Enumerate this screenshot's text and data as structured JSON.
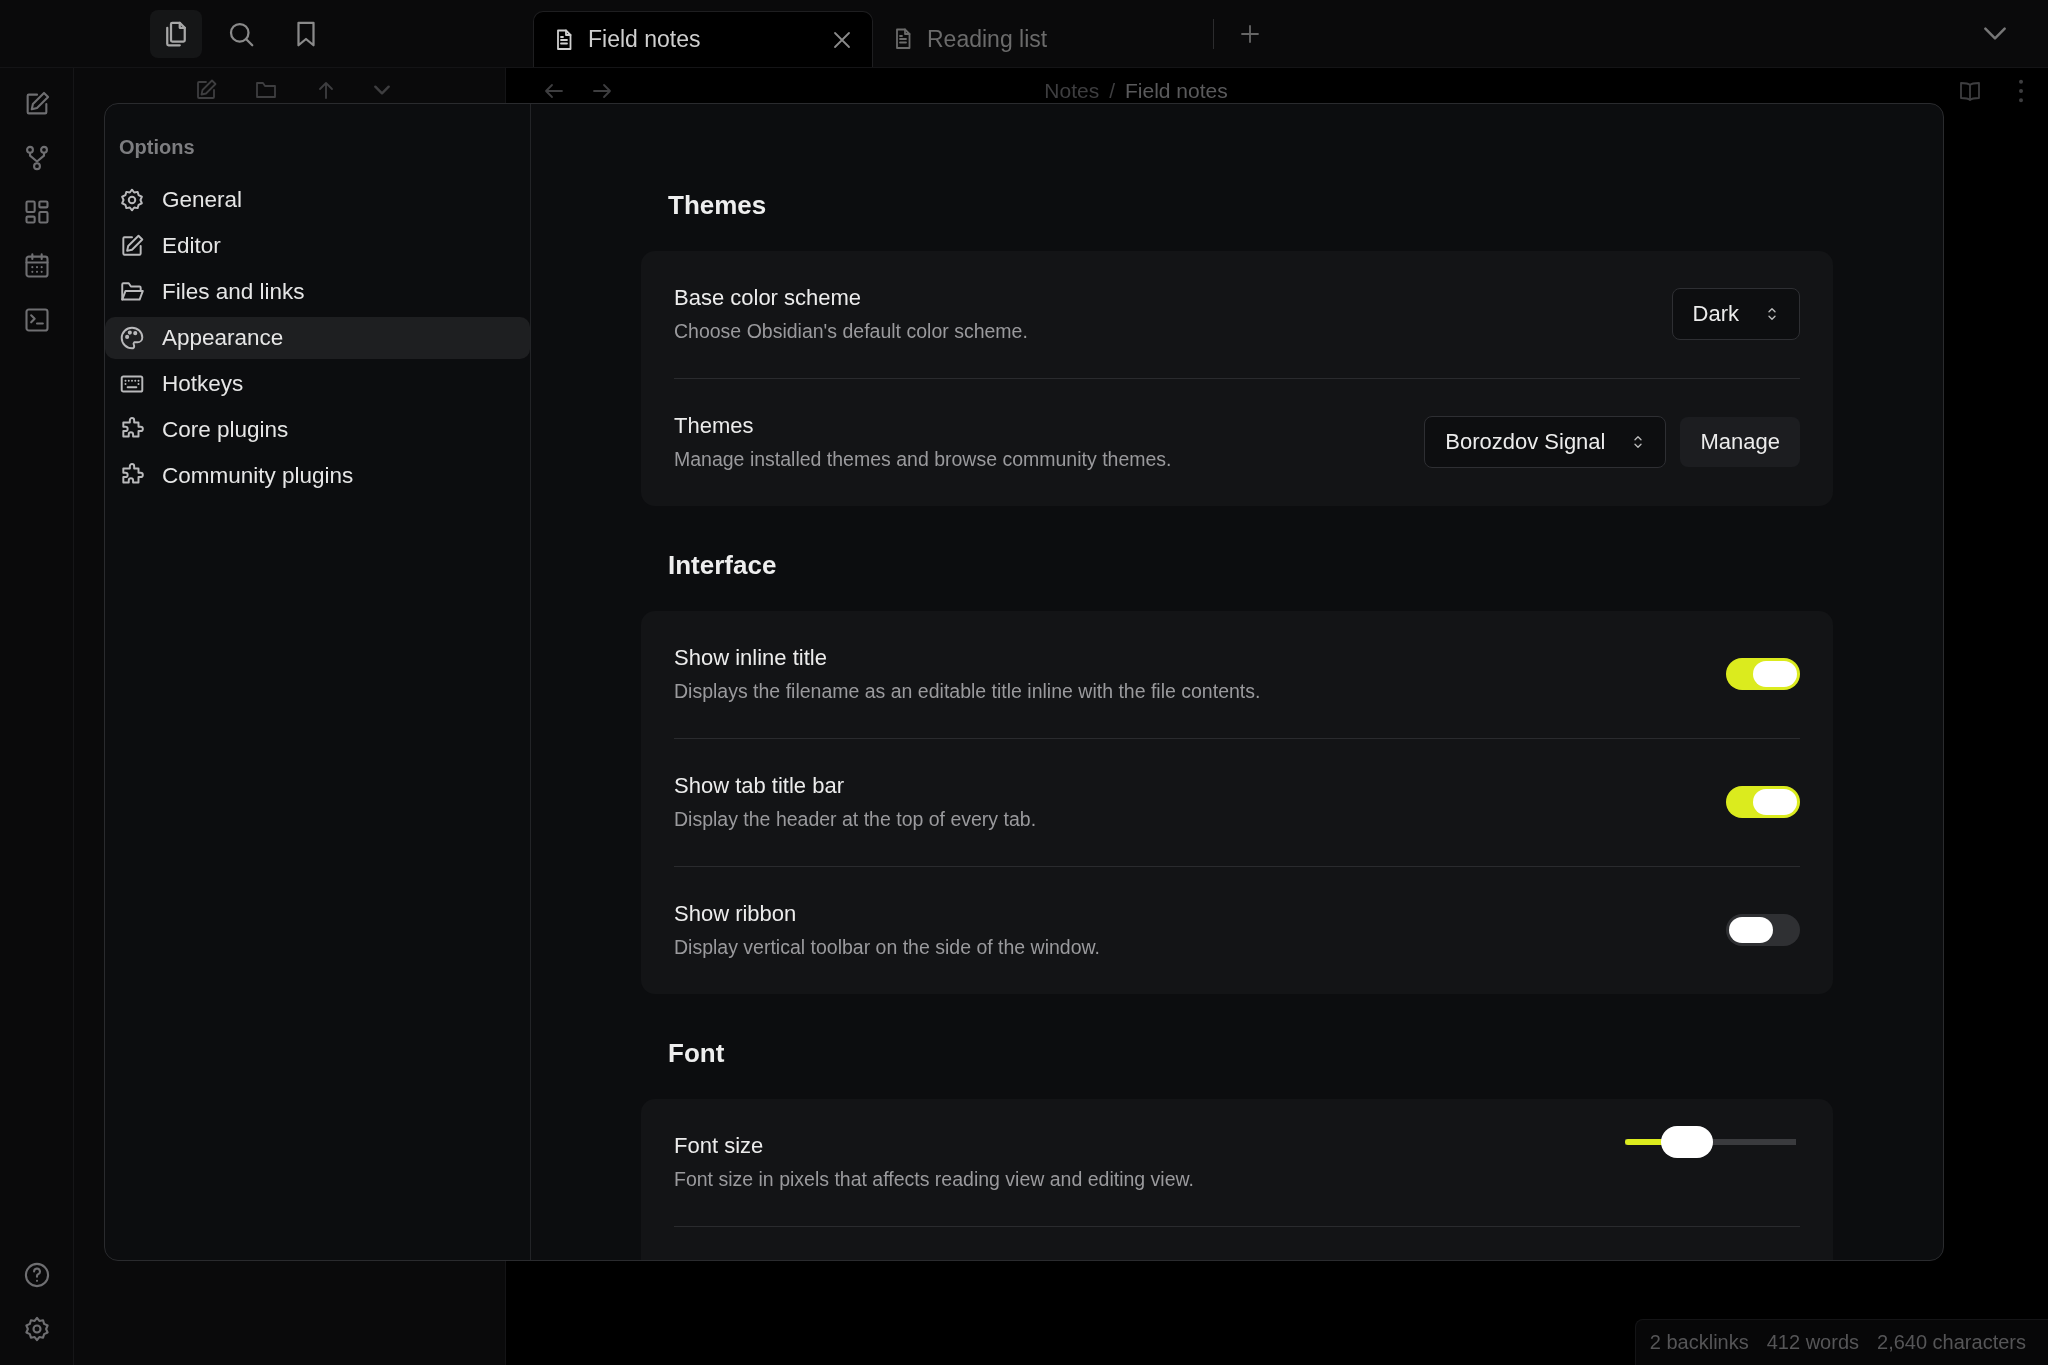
{
  "tabs": [
    {
      "label": "Field notes",
      "selected": true
    },
    {
      "label": "Reading list",
      "selected": false
    }
  ],
  "breadcrumb": {
    "folder": "Notes",
    "separator": "/",
    "current": "Field notes"
  },
  "settings": {
    "sidebar_heading": "Options",
    "nav": [
      {
        "label": "General",
        "selected": false
      },
      {
        "label": "Editor",
        "selected": false
      },
      {
        "label": "Files and links",
        "selected": false
      },
      {
        "label": "Appearance",
        "selected": true
      },
      {
        "label": "Hotkeys",
        "selected": false
      },
      {
        "label": "Core plugins",
        "selected": false
      },
      {
        "label": "Community plugins",
        "selected": false
      }
    ],
    "sections": [
      {
        "title": "Themes",
        "rows": [
          {
            "kind": "select",
            "name": "Base color scheme",
            "description": "Choose Obsidian's default color scheme.",
            "value": "Dark"
          },
          {
            "kind": "select_button",
            "name": "Themes",
            "description": "Manage installed themes and browse community themes.",
            "value": "Borozdov Signal",
            "button": "Manage"
          }
        ]
      },
      {
        "title": "Interface",
        "rows": [
          {
            "kind": "toggle",
            "name": "Show inline title",
            "description": "Displays the filename as an editable title inline with the file contents.",
            "on": true
          },
          {
            "kind": "toggle",
            "name": "Show tab title bar",
            "description": "Display the header at the top of every tab.",
            "on": true
          },
          {
            "kind": "toggle",
            "name": "Show ribbon",
            "description": "Display vertical toolbar on the side of the window.",
            "on": false
          }
        ]
      },
      {
        "title": "Font",
        "rows": [
          {
            "kind": "slider",
            "name": "Font size",
            "description": "Font size in pixels that affects reading view and editing view.",
            "level": 0.36
          }
        ]
      }
    ]
  },
  "status_bar": [
    "2 backlinks",
    "412 words",
    "2,640 characters"
  ]
}
